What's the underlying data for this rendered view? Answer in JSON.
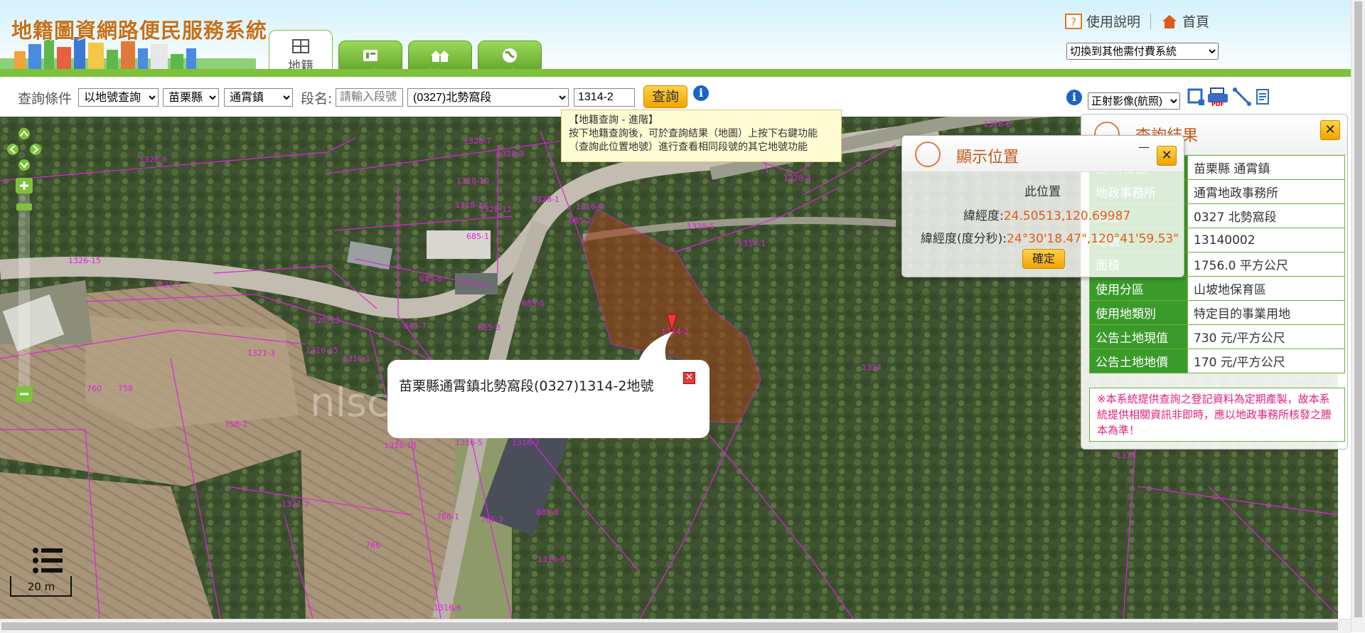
{
  "header": {
    "title": "地籍圖資網路便民服務系統",
    "tabs": [
      {
        "label": "地籍",
        "icon": "map-icon",
        "active": true
      },
      {
        "label": "門牌",
        "icon": "doorplate-icon",
        "active": false
      },
      {
        "label": "村里",
        "icon": "village-icon",
        "active": false
      },
      {
        "label": "坐標",
        "icon": "globe-icon",
        "active": false
      }
    ],
    "help_label": "使用說明",
    "home_label": "首頁",
    "switch_system": "切換到其他需付費系統"
  },
  "query": {
    "condition_label": "查詢條件",
    "query_type": "以地號查詢",
    "county": "苗栗縣",
    "town": "通霄鎮",
    "section_label": "段名:",
    "section_placeholder": "請輸入段號",
    "section_selected": "(0327)北勢窩段",
    "parcel_number": "1314-2",
    "search_button": "查詢",
    "tooltip_title": "【地籍查詢 - 進階】",
    "tooltip_body": "按下地籍查詢後，可於查詢結果（地圖）上按下右鍵功能（查詢此位置地號）進行查看相同段號的其它地號功能",
    "imagery_select": "正射影像(航照)"
  },
  "map": {
    "scale_label": "20 m",
    "watermark": "nlsc.gov.tw",
    "parcel_labels": [
      "1328-7",
      "1328-8",
      "1328-9",
      "1328-10",
      "1328-13",
      "1328-12",
      "1328-1",
      "1328-5",
      "1328-4",
      "1328-6",
      "1314-1",
      "1314-2",
      "1314",
      "1313",
      "1316-1",
      "1316-15",
      "1316-13",
      "1316-5",
      "1316-7",
      "1316-9",
      "1316-6",
      "1316-4",
      "1321-3",
      "1321-2",
      "1321-1",
      "1320-13",
      "1326-15",
      "685-1",
      "685-5",
      "685-6",
      "685-7",
      "685-3",
      "685-2",
      "685-8",
      "758",
      "760",
      "766-1",
      "766",
      "766-2",
      "758-2"
    ],
    "popup_text": "苗栗縣通霄鎮北勢窩段(0327)1314-2地號"
  },
  "position_dialog": {
    "title": "顯示位置",
    "location_label": "此位置",
    "latlon_label": "緯經度:",
    "latlon_value": "24.50513,120.69987",
    "dms_label": "緯經度(度分秒):",
    "dms_value": "24°30'18.47\",120°41'59.53\"",
    "ok_button": "確定",
    "minimize": "—"
  },
  "result_panel": {
    "title": "查詢結果",
    "rows": [
      {
        "key": "縣市/鄉鎮",
        "value": "苗栗縣 通霄鎮"
      },
      {
        "key": "地政事務所",
        "value": "通霄地政事務所"
      },
      {
        "key": "段名",
        "value": "0327 北勢窩段"
      },
      {
        "key": "地號",
        "value": "13140002"
      },
      {
        "key": "面積",
        "value": "1756.0 平方公尺"
      },
      {
        "key": "使用分區",
        "value": "山坡地保育區"
      },
      {
        "key": "使用地類別",
        "value": "特定目的事業用地"
      },
      {
        "key": "公告土地現值",
        "value": "730 元/平方公尺"
      },
      {
        "key": "公告土地地價",
        "value": "170 元/平方公尺"
      }
    ],
    "notice": "※本系統提供查詢之登記資料為定期產製，故本系統提供相關資訊非即時，應以地政事務所核發之謄本為準！"
  },
  "colors": {
    "brand_orange": "#c5701a",
    "green_bar": "#7cc23c",
    "table_key_green": "#3a9a2a",
    "notice_pink": "#e0207a",
    "parcel_magenta": "#e020e0",
    "highlight_parcel": "#a0401a"
  }
}
